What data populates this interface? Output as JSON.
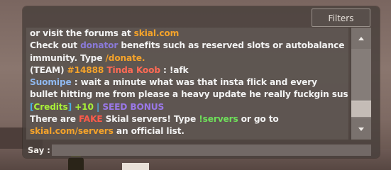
{
  "chat": {
    "filters_label": "Filters",
    "say_label": "Say :",
    "say_value": "",
    "lines": {
      "l1": {
        "a": "or visit the forums at ",
        "b": "skial.com"
      },
      "l2": {
        "a": "Check out ",
        "b": "donator",
        "c": " benefits such as reserved slots or autobalance"
      },
      "l3": {
        "a": "immunity. Type ",
        "b": "/donate."
      },
      "l4": {
        "a": "(TEAM) ",
        "b": "#14888",
        "c": " ",
        "d": "Tinda Koob",
        "e": " :  !afk"
      },
      "l5": {
        "a": "Suomipe",
        "b": " :  wait a minute what was that insta flick and every"
      },
      "l6": {
        "a": "bullet hitting me from please a heavy update he really fuckgin sus"
      },
      "l7": {
        "a": "[",
        "b": "Credits",
        "c": "]",
        "d": " +10",
        "e": " | ",
        "f": "SEED BONUS"
      },
      "l8": {
        "a": "There are ",
        "b": "FAKE",
        "c": " Skial servers! Type ",
        "d": "!servers",
        "e": " or go to"
      },
      "l9": {
        "a": "skial.com/servers",
        "b": " an official list."
      }
    }
  },
  "colors": {
    "link_orange": "#f5a32a",
    "donator_purple": "#8a7ad8",
    "player_blue": "#8fb8f0",
    "warning_red": "#ff5a4a",
    "command_green": "#6ee05a",
    "credits_teal": "#4ab0e8",
    "bonus_lime": "#a8f038",
    "seed_violet": "#9a78e8"
  },
  "icons": {
    "scroll_up": "triangle-up",
    "scroll_down": "triangle-down"
  }
}
